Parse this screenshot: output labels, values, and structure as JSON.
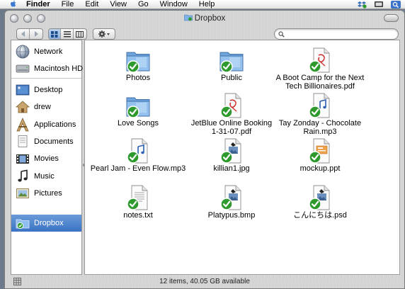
{
  "menubar": {
    "app_name": "Finder",
    "items": [
      "File",
      "Edit",
      "View",
      "Go",
      "Window",
      "Help"
    ]
  },
  "window": {
    "title": "Dropbox",
    "search_placeholder": ""
  },
  "sidebar": {
    "devices": [
      {
        "label": "Network",
        "icon": "network-icon"
      },
      {
        "label": "Macintosh HD",
        "icon": "hard-drive-icon"
      }
    ],
    "places": [
      {
        "label": "Desktop",
        "icon": "desktop-icon"
      },
      {
        "label": "drew",
        "icon": "home-icon"
      },
      {
        "label": "Applications",
        "icon": "applications-icon"
      },
      {
        "label": "Documents",
        "icon": "documents-icon"
      },
      {
        "label": "Movies",
        "icon": "movies-icon"
      },
      {
        "label": "Music",
        "icon": "music-icon"
      },
      {
        "label": "Pictures",
        "icon": "pictures-icon"
      },
      {
        "label": "Dropbox",
        "icon": "dropbox-icon",
        "selected": true
      }
    ]
  },
  "files": [
    {
      "name": "Photos",
      "type": "folder"
    },
    {
      "name": "Public",
      "type": "folder"
    },
    {
      "name": "A Boot Camp for the Next\nTech Billionaires.pdf",
      "type": "pdf"
    },
    {
      "name": "Love Songs",
      "type": "folder"
    },
    {
      "name": "JetBlue Online Booking\n1-31-07.pdf",
      "type": "pdf"
    },
    {
      "name": "Tay Zonday - Chocolate\nRain.mp3",
      "type": "mp3"
    },
    {
      "name": "Pearl Jam - Even Flow.mp3",
      "type": "mp3"
    },
    {
      "name": "killian1.jpg",
      "type": "image"
    },
    {
      "name": "mockup.ppt",
      "type": "ppt"
    },
    {
      "name": "notes.txt",
      "type": "text"
    },
    {
      "name": "Platypus.bmp",
      "type": "image"
    },
    {
      "name": "こんにちは.psd",
      "type": "image"
    }
  ],
  "status": {
    "text": "12 items, 40.05 GB available"
  },
  "colors": {
    "selection": "#3a73c4",
    "sync_badge": "#2e9a2e",
    "folder": "#7fb2e6"
  }
}
